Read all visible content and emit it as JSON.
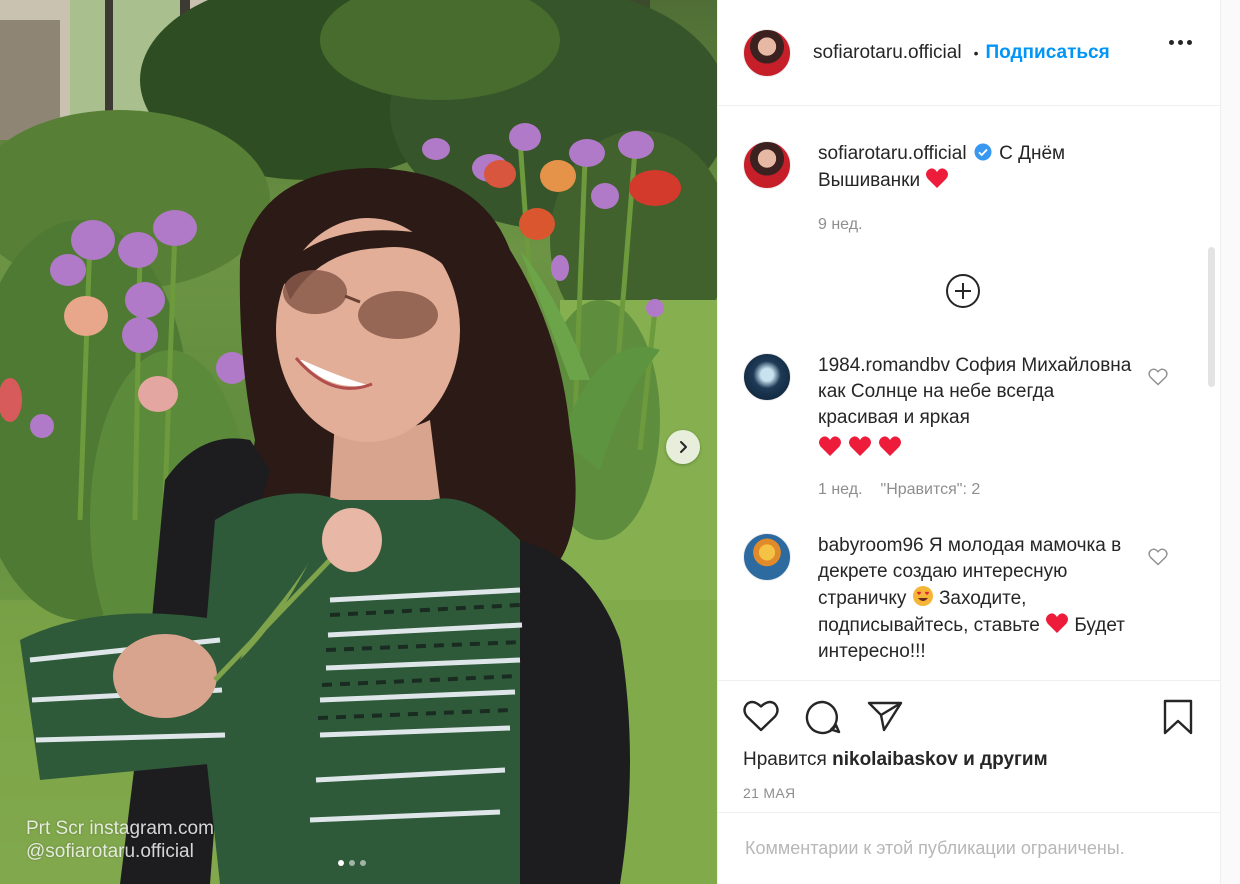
{
  "photo": {
    "watermark_line1": "Prt Scr instagram.com",
    "watermark_line2": "@sofiarotaru.official",
    "next_icon": "chevron-right-icon",
    "carousel_count": 3,
    "carousel_active": 1
  },
  "header": {
    "username": "sofiarotaru.official",
    "separator": "•",
    "follow_label": "Подписаться",
    "more_icon": "more-horizontal-icon"
  },
  "caption": {
    "username": "sofiarotaru.official",
    "text": "С Днём Вышиванки",
    "time": "9 нед."
  },
  "load_more_icon": "plus-circle-icon",
  "comments": [
    {
      "username": "1984.romandbv",
      "text": "София Михайловна как Солнце на небе всегда красивая и яркая",
      "hearts": 3,
      "time": "1 нед.",
      "likes": "\"Нравится\": 2"
    },
    {
      "username": "babyroom96",
      "text_before": "Я молодая мамочка в декрете создаю интересную страничку",
      "text_middle": "Заходите, подписывайтесь, ставьте",
      "text_after": "Будет интересно!!!"
    }
  ],
  "actions": {
    "like_icon": "heart-icon",
    "comment_icon": "comment-icon",
    "share_icon": "paper-plane-icon",
    "save_icon": "bookmark-icon",
    "likes_prefix": "Нравится",
    "likes_user": "nikolaibaskov",
    "likes_suffix": "и другим",
    "date": "21 МАЯ"
  },
  "footer": {
    "comments_disabled": "Комментарии к этой публикации ограничены."
  },
  "colors": {
    "accent": "#0095f6",
    "heart": "#ed1c3a",
    "muted": "#8e8e8e"
  }
}
